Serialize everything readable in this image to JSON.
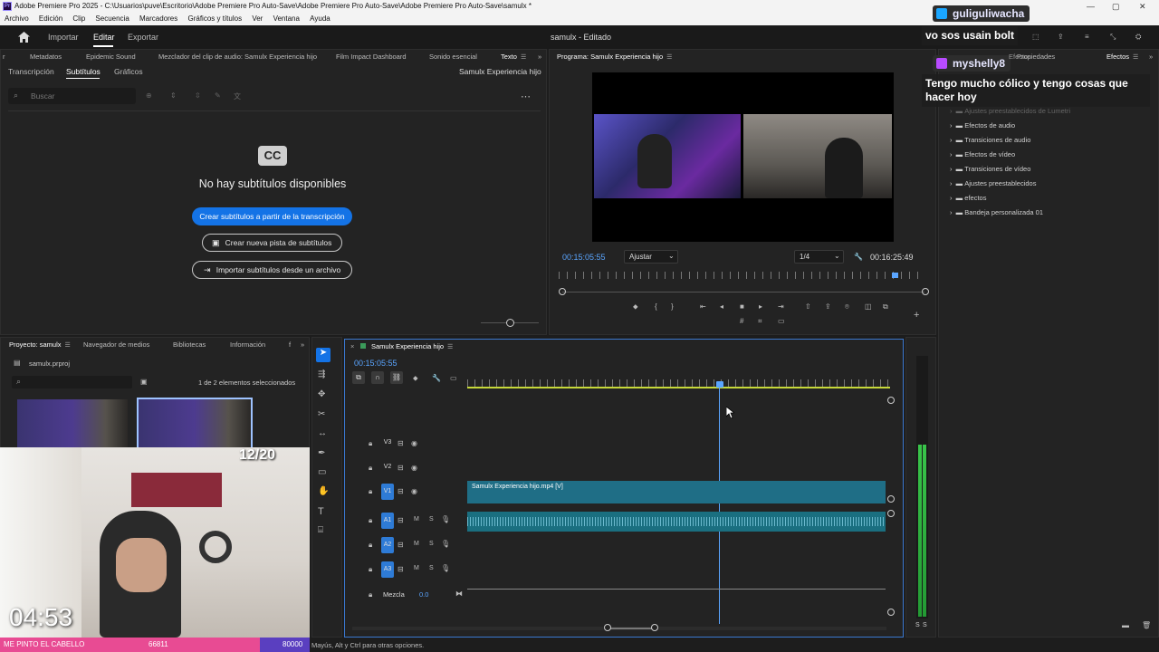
{
  "window": {
    "title": "Adobe Premiere Pro 2025 - C:\\Usuarios\\puve\\Escritorio\\Adobe Premiere Pro Auto-Save\\Adobe Premiere Pro Auto-Save\\Adobe Premiere Pro Auto-Save\\samulx *",
    "logo_text": "Pr"
  },
  "menu": [
    "Archivo",
    "Edición",
    "Clip",
    "Secuencia",
    "Marcadores",
    "Gráficos y títulos",
    "Ver",
    "Ventana",
    "Ayuda"
  ],
  "workspace": {
    "items": [
      "Importar",
      "Editar",
      "Exportar"
    ],
    "active": "Editar",
    "project_title": "samulx - Editado"
  },
  "top_left_panel": {
    "tabs": [
      "Metadatos",
      "Epidemic Sound",
      "Mezclador del clip de audio: Samulx Experiencia hijo",
      "Film Impact Dashboard",
      "Sonido esencial",
      "Texto"
    ],
    "subtabs": [
      "Transcripción",
      "Subtítulos",
      "Gráficos"
    ],
    "active_subtab": "Subtítulos",
    "sequence_name": "Samulx Experiencia hijo",
    "search_placeholder": "Buscar",
    "cc_badge": "CC",
    "empty_message": "No hay subtítulos disponibles",
    "btn_create": "Crear subtítulos a partir de la transcripción",
    "btn_new_track": "Crear nueva pista de subtítulos",
    "btn_import": "Importar subtítulos desde un archivo"
  },
  "program_monitor": {
    "title": "Programa: Samulx Experiencia hijo",
    "timecode": "00:15:05:55",
    "fit": "Ajustar",
    "resolution": "1/4",
    "duration": "00:16:25:49"
  },
  "effects_panel": {
    "tabs": [
      "Propiedades",
      "Efectos"
    ],
    "active_tab": "Efectos",
    "items": [
      "Ajustes preestablecidos de Lumetri",
      "Efectos de audio",
      "Transiciones de audio",
      "Efectos de vídeo",
      "Transiciones de vídeo",
      "Ajustes preestablecidos",
      "efectos",
      "Bandeja personalizada 01"
    ]
  },
  "project_panel": {
    "tabs": [
      "Proyecto: samulx",
      "Navegador de medios",
      "Bibliotecas",
      "Información"
    ],
    "file": "samulx.prproj",
    "selection_info": "1 de 2 elementos seleccionados"
  },
  "timeline": {
    "tab": "Samulx Experiencia hijo",
    "timecode": "00:15:05:55",
    "video_tracks": [
      "V3",
      "V2",
      "V1"
    ],
    "audio_tracks": [
      "A1",
      "A2",
      "A3"
    ],
    "mix_label": "Mezcla",
    "mix_value": "0.0",
    "clip_label": "Samulx Experiencia hijo.mp4 [V]",
    "track_m": "M",
    "track_s": "S"
  },
  "meters": {
    "labels": [
      "S",
      "S"
    ]
  },
  "status_bar": "Mayús, Alt y Ctrl para otras opciones.",
  "chat": [
    {
      "user": "guliguliwacha",
      "message": "vo sos usain bolt"
    },
    {
      "user": "myshelly8",
      "message": "Tengo mucho cólico y tengo cosas que hacer hoy"
    }
  ],
  "chat_hidden": "Efectos",
  "webcam_overlay": {
    "counter": "12/20",
    "clock": "04:53",
    "bar_text": "ME PINTO EL CABELLO",
    "bar_count": "66811",
    "bar_goal": "80000"
  },
  "colors": {
    "accent": "#1473e6",
    "clip": "#1f6e86",
    "audio": "#1a6f80",
    "playhead": "#5aa5ff",
    "timebar_yellow": "#c7d93a"
  }
}
